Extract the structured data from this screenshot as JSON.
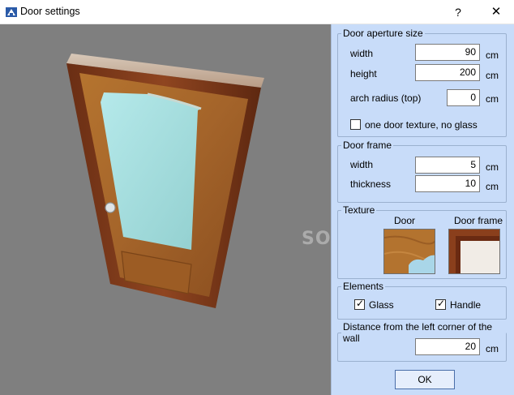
{
  "window": {
    "title": "Door settings",
    "help_label": "?",
    "close_label": "✕"
  },
  "aperture": {
    "legend": "Door aperture size",
    "width_label": "width",
    "width_value": "90",
    "height_label": "height",
    "height_value": "200",
    "arch_label": "arch radius (top)",
    "arch_value": "0",
    "unit": "cm",
    "single_texture_label": "one door texture, no glass",
    "single_texture_checked": false
  },
  "frame": {
    "legend": "Door frame",
    "width_label": "width",
    "width_value": "5",
    "thickness_label": "thickness",
    "thickness_value": "10",
    "unit": "cm"
  },
  "texture": {
    "legend": "Texture",
    "door_label": "Door",
    "frame_label": "Door frame"
  },
  "elements": {
    "legend": "Elements",
    "glass_label": "Glass",
    "glass_checked": true,
    "handle_label": "Handle",
    "handle_checked": true
  },
  "distance": {
    "legend": "Distance from the left corner of the wall",
    "value": "20",
    "unit": "cm"
  },
  "ok_label": "OK",
  "watermark": "SOFTPEDIA"
}
